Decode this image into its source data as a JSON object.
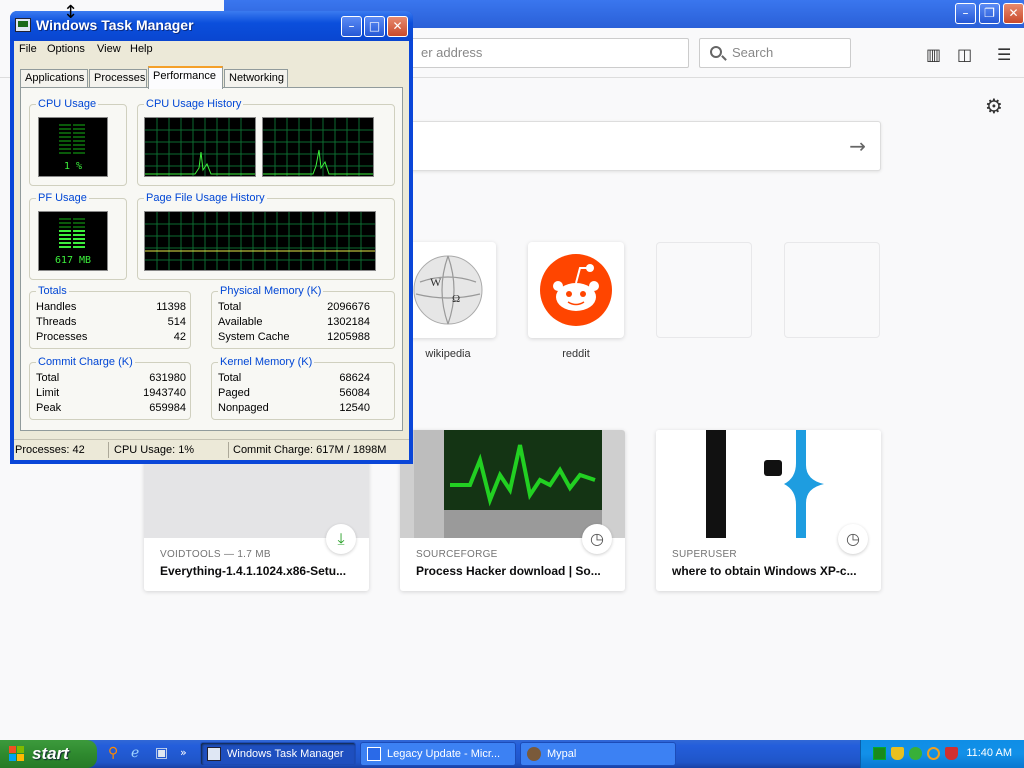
{
  "browser": {
    "url_placeholder": "er address",
    "search_placeholder": "Search",
    "top_sites": [
      {
        "label": "wikipedia"
      },
      {
        "label": "reddit"
      }
    ],
    "highlights": [
      {
        "source": "VOIDTOOLS — 1.7 MB",
        "title": "Everything-1.4.1.1024.x86-Setu..."
      },
      {
        "source": "SOURCEFORGE",
        "title": "Process Hacker download | So..."
      },
      {
        "source": "SUPERUSER",
        "title": "where to obtain Windows XP-c..."
      }
    ]
  },
  "taskmgr": {
    "title": "Windows Task Manager",
    "menu": [
      "File",
      "Options",
      "View",
      "Help"
    ],
    "tabs": [
      "Applications",
      "Processes",
      "Performance",
      "Networking"
    ],
    "active_tab": "Performance",
    "cpu_usage": {
      "title": "CPU Usage",
      "value": "1 %"
    },
    "cpu_history": {
      "title": "CPU Usage History"
    },
    "pf_usage": {
      "title": "PF Usage",
      "value": "617 MB"
    },
    "pf_history": {
      "title": "Page File Usage History"
    },
    "totals": {
      "title": "Totals",
      "rows": [
        {
          "label": "Handles",
          "value": "11398"
        },
        {
          "label": "Threads",
          "value": "514"
        },
        {
          "label": "Processes",
          "value": "42"
        }
      ]
    },
    "physical_memory": {
      "title": "Physical Memory (K)",
      "rows": [
        {
          "label": "Total",
          "value": "2096676"
        },
        {
          "label": "Available",
          "value": "1302184"
        },
        {
          "label": "System Cache",
          "value": "1205988"
        }
      ]
    },
    "commit_charge": {
      "title": "Commit Charge (K)",
      "rows": [
        {
          "label": "Total",
          "value": "631980"
        },
        {
          "label": "Limit",
          "value": "1943740"
        },
        {
          "label": "Peak",
          "value": "659984"
        }
      ]
    },
    "kernel_memory": {
      "title": "Kernel Memory (K)",
      "rows": [
        {
          "label": "Total",
          "value": "68624"
        },
        {
          "label": "Paged",
          "value": "56084"
        },
        {
          "label": "Nonpaged",
          "value": "12540"
        }
      ]
    },
    "status": {
      "processes": "Processes: 42",
      "cpu": "CPU Usage: 1%",
      "commit": "Commit Charge: 617M / 1898M"
    }
  },
  "taskbar": {
    "start_label": "start",
    "tasks": [
      {
        "label": "Windows Task Manager",
        "active": true
      },
      {
        "label": "Legacy Update - Micr...",
        "active": false
      },
      {
        "label": "Mypal",
        "active": false
      }
    ],
    "quicklaunch_more": "»",
    "clock": "11:40 AM"
  },
  "colors": {
    "xp_blue": "#0a46d8",
    "graph_green": "#3cf03c",
    "reddit_orange": "#ff4500",
    "start_green": "#2f8a2f"
  }
}
